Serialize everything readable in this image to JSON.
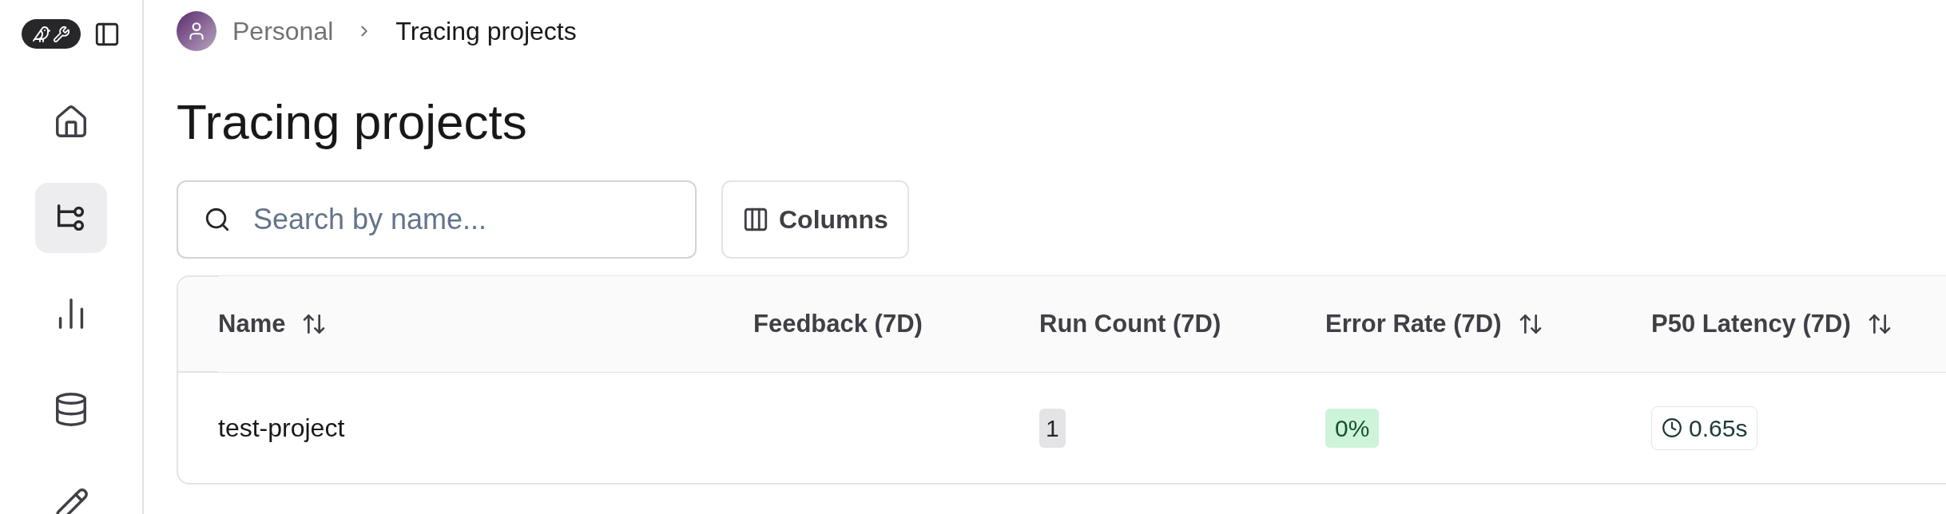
{
  "breadcrumb": [
    {
      "label": "Personal",
      "kind": "workspace"
    },
    {
      "label": "Tracing projects",
      "kind": "page"
    }
  ],
  "sidebar": {
    "items": [
      {
        "selected": false
      },
      {
        "selected": true
      },
      {
        "selected": false
      },
      {
        "selected": false
      },
      {
        "selected": false
      }
    ]
  },
  "title": "Tracing projects",
  "search": {
    "placeholder": "Search by name..."
  },
  "columns_button": "Columns",
  "table": {
    "columns": [
      {
        "label": "Name",
        "sortable": true
      },
      {
        "label": "Feedback (7D)",
        "sortable": false
      },
      {
        "label": "Run Count (7D)",
        "sortable": false
      },
      {
        "label": "Error Rate (7D)",
        "sortable": true
      },
      {
        "label": "P50 Latency (7D)",
        "sortable": true
      }
    ],
    "rows": [
      {
        "cells": [
          {
            "kind": "text",
            "text": "test-project"
          },
          {
            "kind": "empty"
          },
          {
            "kind": "count",
            "text": "1"
          },
          {
            "kind": "rate",
            "text": "0%"
          },
          {
            "kind": "latency",
            "text": "0.65s"
          }
        ]
      }
    ]
  }
}
